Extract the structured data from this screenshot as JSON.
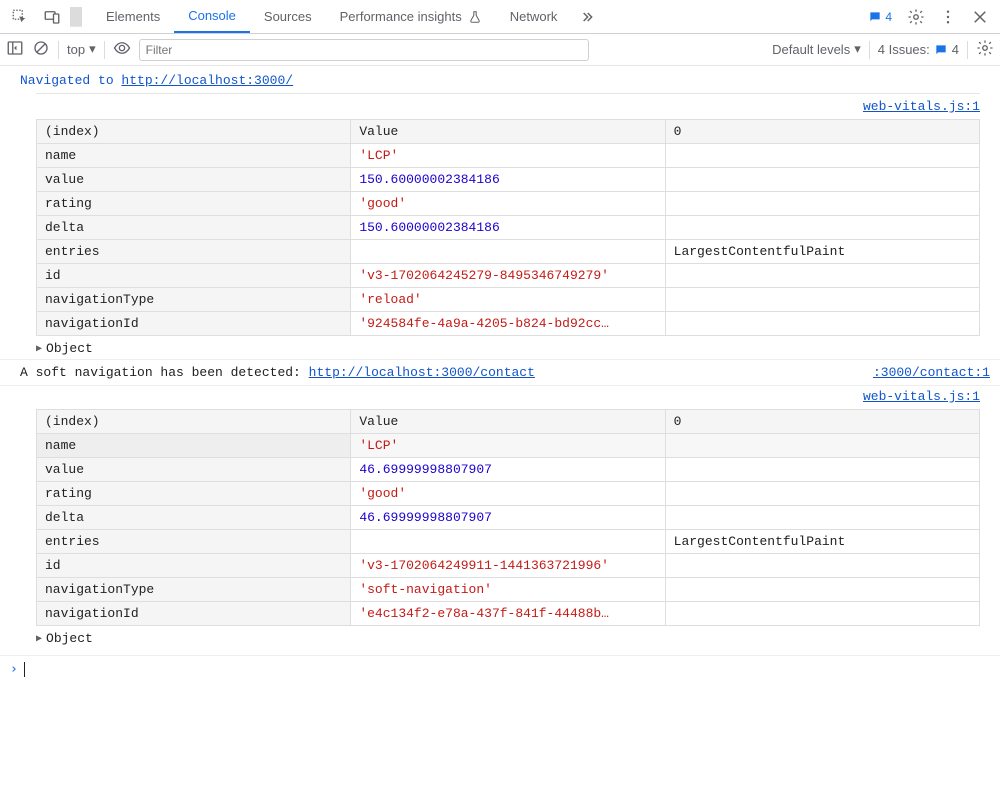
{
  "topbar": {
    "tabs": [
      "Elements",
      "Console",
      "Sources",
      "Performance insights",
      "Network"
    ],
    "active_tab": "Console",
    "message_count": "4"
  },
  "toolbar": {
    "context": "top",
    "filter_placeholder": "Filter",
    "levels_label": "Default levels",
    "issues_label": "4 Issues:",
    "issues_count": "4"
  },
  "logs": {
    "nav1_prefix": "Navigated to ",
    "nav1_url": "http://localhost:3000/",
    "src_link1": "web-vitals.js:1",
    "table1": {
      "headers": [
        "(index)",
        "Value",
        "0"
      ],
      "rows": [
        {
          "key": "name",
          "val": "'LCP'",
          "type": "str",
          "col0": ""
        },
        {
          "key": "value",
          "val": "150.60000002384186",
          "type": "num",
          "col0": ""
        },
        {
          "key": "rating",
          "val": "'good'",
          "type": "str",
          "col0": ""
        },
        {
          "key": "delta",
          "val": "150.60000002384186",
          "type": "num",
          "col0": ""
        },
        {
          "key": "entries",
          "val": "",
          "type": "plain",
          "col0": "LargestContentfulPaint"
        },
        {
          "key": "id",
          "val": "'v3-1702064245279-8495346749279'",
          "type": "str",
          "col0": ""
        },
        {
          "key": "navigationType",
          "val": "'reload'",
          "type": "str",
          "col0": ""
        },
        {
          "key": "navigationId",
          "val": "'924584fe-4a9a-4205-b824-bd92cc…",
          "type": "str",
          "col0": ""
        }
      ]
    },
    "expander1": "Object",
    "softnav_prefix": "A soft navigation has been detected: ",
    "softnav_url": "http://localhost:3000/contact",
    "softnav_src": ":3000/contact:1",
    "src_link2": "web-vitals.js:1",
    "table2": {
      "headers": [
        "(index)",
        "Value",
        "0"
      ],
      "rows": [
        {
          "key": "name",
          "val": "'LCP'",
          "type": "str",
          "col0": ""
        },
        {
          "key": "value",
          "val": "46.69999998807907",
          "type": "num",
          "col0": ""
        },
        {
          "key": "rating",
          "val": "'good'",
          "type": "str",
          "col0": ""
        },
        {
          "key": "delta",
          "val": "46.69999998807907",
          "type": "num",
          "col0": ""
        },
        {
          "key": "entries",
          "val": "",
          "type": "plain",
          "col0": "LargestContentfulPaint"
        },
        {
          "key": "id",
          "val": "'v3-1702064249911-1441363721996'",
          "type": "str",
          "col0": ""
        },
        {
          "key": "navigationType",
          "val": "'soft-navigation'",
          "type": "str",
          "col0": ""
        },
        {
          "key": "navigationId",
          "val": "'e4c134f2-e78a-437f-841f-44488b…",
          "type": "str",
          "col0": ""
        }
      ]
    },
    "expander2": "Object"
  }
}
